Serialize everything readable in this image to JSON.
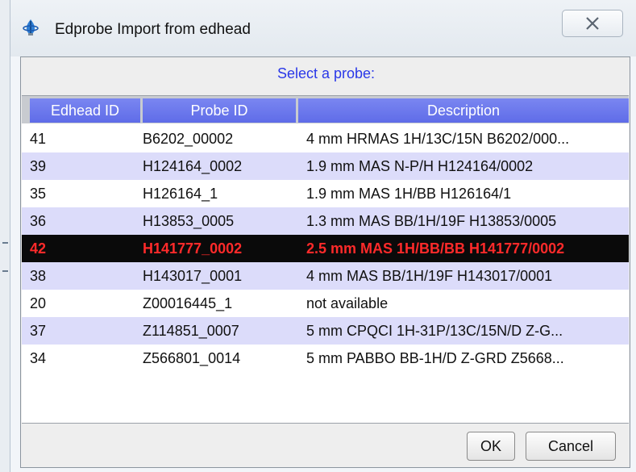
{
  "window": {
    "title": "Edprobe Import from edhead",
    "icon": "edprobe-app-icon",
    "close_icon": "close-icon"
  },
  "dialog": {
    "prompt": "Select a probe:",
    "ok_label": "OK",
    "cancel_label": "Cancel"
  },
  "table": {
    "headers": [
      "Edhead ID",
      "Probe ID",
      "Description"
    ],
    "rows": [
      {
        "id": "41",
        "probe": "B6202_00002",
        "desc": "4 mm HRMAS 1H/13C/15N B6202/000...",
        "selected": false
      },
      {
        "id": "39",
        "probe": "H124164_0002",
        "desc": "1.9 mm MAS N-P/H H124164/0002",
        "selected": false
      },
      {
        "id": "35",
        "probe": "H126164_1",
        "desc": "1.9 mm MAS 1H/BB H126164/1",
        "selected": false
      },
      {
        "id": "36",
        "probe": "H13853_0005",
        "desc": "1.3 mm MAS BB/1H/19F H13853/0005",
        "selected": false
      },
      {
        "id": "42",
        "probe": "H141777_0002",
        "desc": "2.5 mm MAS 1H/BB/BB H141777/0002",
        "selected": true
      },
      {
        "id": "38",
        "probe": "H143017_0001",
        "desc": "4 mm MAS BB/1H/19F H143017/0001",
        "selected": false
      },
      {
        "id": "20",
        "probe": "Z00016445_1",
        "desc": "not available",
        "selected": false
      },
      {
        "id": "37",
        "probe": "Z114851_0007",
        "desc": "5 mm CPQCI 1H-31P/13C/15N/D Z-G...",
        "selected": false
      },
      {
        "id": "34",
        "probe": "Z566801_0014",
        "desc": "5 mm PABBO BB-1H/D Z-GRD Z5668...",
        "selected": false
      }
    ]
  },
  "colors": {
    "header_bg": "#6a76ec",
    "alt_row": "#dcdcfa",
    "selected_bg": "#0a0a0a",
    "selected_text": "#ff2a2a",
    "prompt_text": "#2a38e8"
  }
}
